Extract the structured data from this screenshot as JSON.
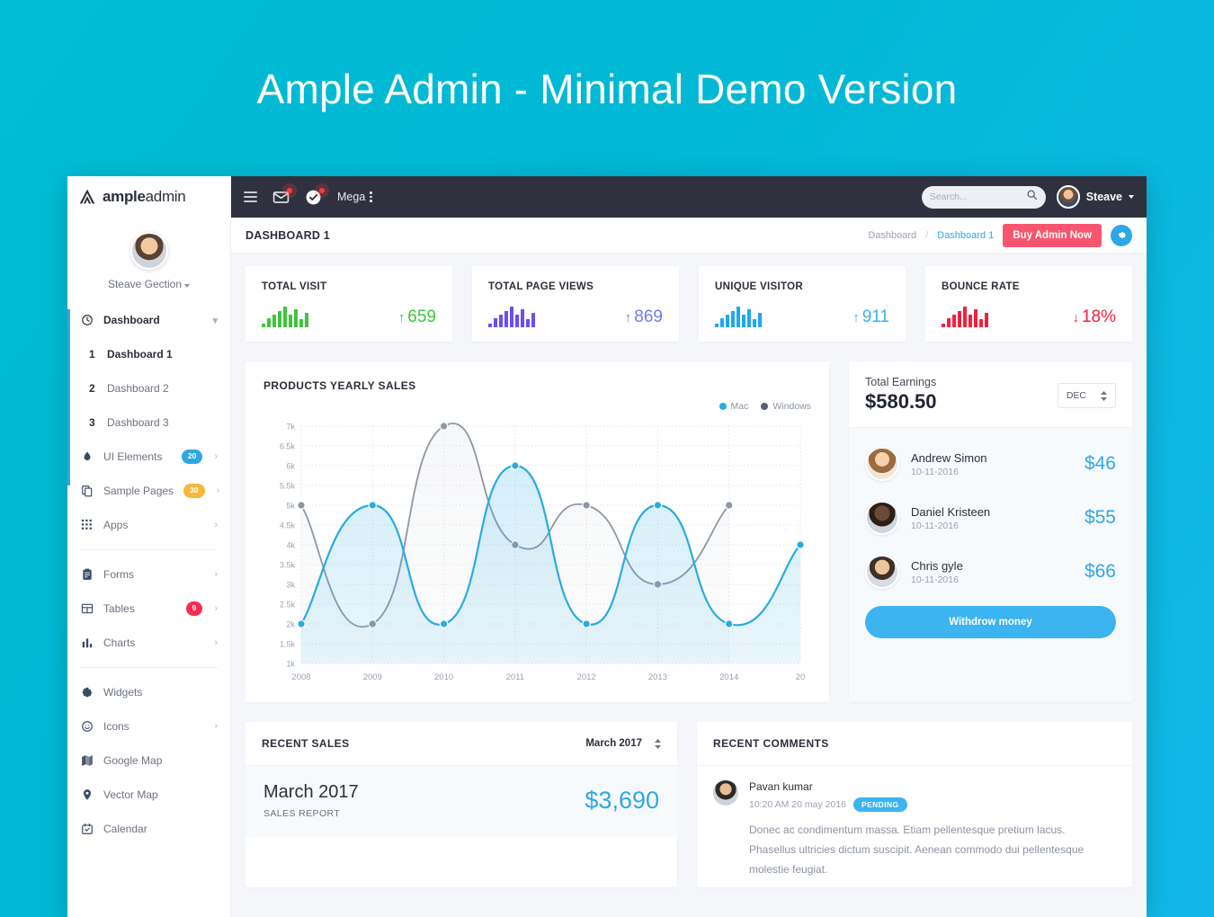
{
  "banner": {
    "title": "Ample Admin - Minimal Demo Version"
  },
  "brand": {
    "bold": "ample",
    "light": "admin",
    "logo_icon": "triangle-logo-icon"
  },
  "navbar": {
    "mega_label": "Mega",
    "search_placeholder": "Search...",
    "search_value": "",
    "user_name": "Steave"
  },
  "sidebar": {
    "profile_name": "Steave Gection",
    "items": [
      {
        "label": "Dashboard",
        "icon": "clock-icon",
        "chevron": "⌄",
        "active": true
      },
      {
        "label": "Dashboard 1",
        "num": "1",
        "sub": true,
        "active": true
      },
      {
        "label": "Dashboard 2",
        "num": "2",
        "sub": true
      },
      {
        "label": "Dashboard 3",
        "num": "3",
        "sub": true
      },
      {
        "label": "UI Elements",
        "icon": "droplet-icon",
        "badge": "20",
        "badge_color": "blue",
        "chevron": "›"
      },
      {
        "label": "Sample Pages",
        "icon": "copy-icon",
        "badge": "30",
        "badge_color": "amber",
        "chevron": "›"
      },
      {
        "label": "Apps",
        "icon": "grid-icon",
        "chevron": "›"
      },
      {
        "label": "Forms",
        "icon": "clipboard-icon",
        "chevron": "›"
      },
      {
        "label": "Tables",
        "icon": "table-icon",
        "badge": "9",
        "badge_color": "red",
        "chevron": "›"
      },
      {
        "label": "Charts",
        "icon": "bar-chart-icon",
        "chevron": "›"
      },
      {
        "label": "Widgets",
        "icon": "gear-icon"
      },
      {
        "label": "Icons",
        "icon": "smiley-icon",
        "chevron": "›"
      },
      {
        "label": "Google Map",
        "icon": "map-icon"
      },
      {
        "label": "Vector Map",
        "icon": "pin-icon"
      },
      {
        "label": "Calendar",
        "icon": "calendar-icon"
      }
    ]
  },
  "pagebar": {
    "title": "DASHBOARD 1",
    "breadcrumb_root": "Dashboard",
    "breadcrumb_sep": "/",
    "breadcrumb_current": "Dashboard 1",
    "buy_label": "Buy Admin Now",
    "gear_icon": "gear-icon"
  },
  "stats": [
    {
      "title": "TOTAL VISIT",
      "value": "659",
      "arrow": "↑",
      "color": "#3dc53d",
      "bars": [
        4,
        10,
        14,
        18,
        23,
        14,
        20,
        9,
        16
      ]
    },
    {
      "title": "TOTAL PAGE VIEWS",
      "value": "869",
      "arrow": "↑",
      "color": "#6c4df6",
      "bars": [
        4,
        10,
        14,
        18,
        23,
        14,
        20,
        9,
        16
      ]
    },
    {
      "title": "UNIQUE VISITOR",
      "value": "911",
      "arrow": "↑",
      "color": "#1ea7f0",
      "bars": [
        4,
        10,
        14,
        18,
        23,
        14,
        20,
        9,
        16
      ]
    },
    {
      "title": "BOUNCE RATE",
      "value": "18%",
      "arrow": "↓",
      "color": "#f3203c",
      "bars": [
        4,
        10,
        14,
        18,
        23,
        14,
        20,
        9,
        16
      ]
    }
  ],
  "chart_card": {
    "title": "PRODUCTS YEARLY SALES"
  },
  "chart_data": {
    "type": "line",
    "title": "PRODUCTS YEARLY SALES",
    "xlabel": "",
    "ylabel": "",
    "grid": true,
    "legend_position": "top-right",
    "x": [
      "2008",
      "2009",
      "2010",
      "2011",
      "2012",
      "2013",
      "2014",
      "20"
    ],
    "ylim": [
      1000,
      7000
    ],
    "ytick_labels": [
      "7k",
      "6.5k",
      "6k",
      "5.5k",
      "5k",
      "4.5k",
      "4k",
      "3.5k",
      "3k",
      "2.5k",
      "2k",
      "1.5k",
      "1k"
    ],
    "yticks": [
      7000,
      6500,
      6000,
      5500,
      5000,
      4500,
      4000,
      3500,
      3000,
      2500,
      2000,
      1500,
      1000
    ],
    "series": [
      {
        "name": "Mac",
        "color": "#29abe2",
        "values": [
          2000,
          5000,
          2000,
          6000,
          2000,
          5000,
          2000,
          4000
        ]
      },
      {
        "name": "Windows",
        "color": "#8d97a6",
        "values": [
          5000,
          2000,
          7000,
          4000,
          5000,
          3000,
          5000,
          null
        ]
      }
    ]
  },
  "earnings": {
    "label": "Total Earnings",
    "amount": "$580.50",
    "month": "DEC",
    "rows": [
      {
        "name": "Andrew Simon",
        "date": "10-11-2016",
        "amount": "$46"
      },
      {
        "name": "Daniel Kristeen",
        "date": "10-11-2016",
        "amount": "$55"
      },
      {
        "name": "Chris gyle",
        "date": "10-11-2016",
        "amount": "$66"
      }
    ],
    "withdraw_label": "Withdrow money"
  },
  "recent_sales": {
    "title": "RECENT SALES",
    "select_value": "March 2017",
    "row_title": "March 2017",
    "row_sub": "SALES REPORT",
    "row_amount": "$3,690"
  },
  "recent_comments": {
    "title": "RECENT COMMENTS",
    "comment": {
      "author": "Pavan kumar",
      "time": "10:20 AM 20 may 2016",
      "status": "PENDING",
      "text": "Donec ac condimentum massa. Etiam pellentesque pretium lacus. Phasellus ultricies dictum suscipit. Aenean commodo dui pellentesque molestie feugiat."
    }
  }
}
